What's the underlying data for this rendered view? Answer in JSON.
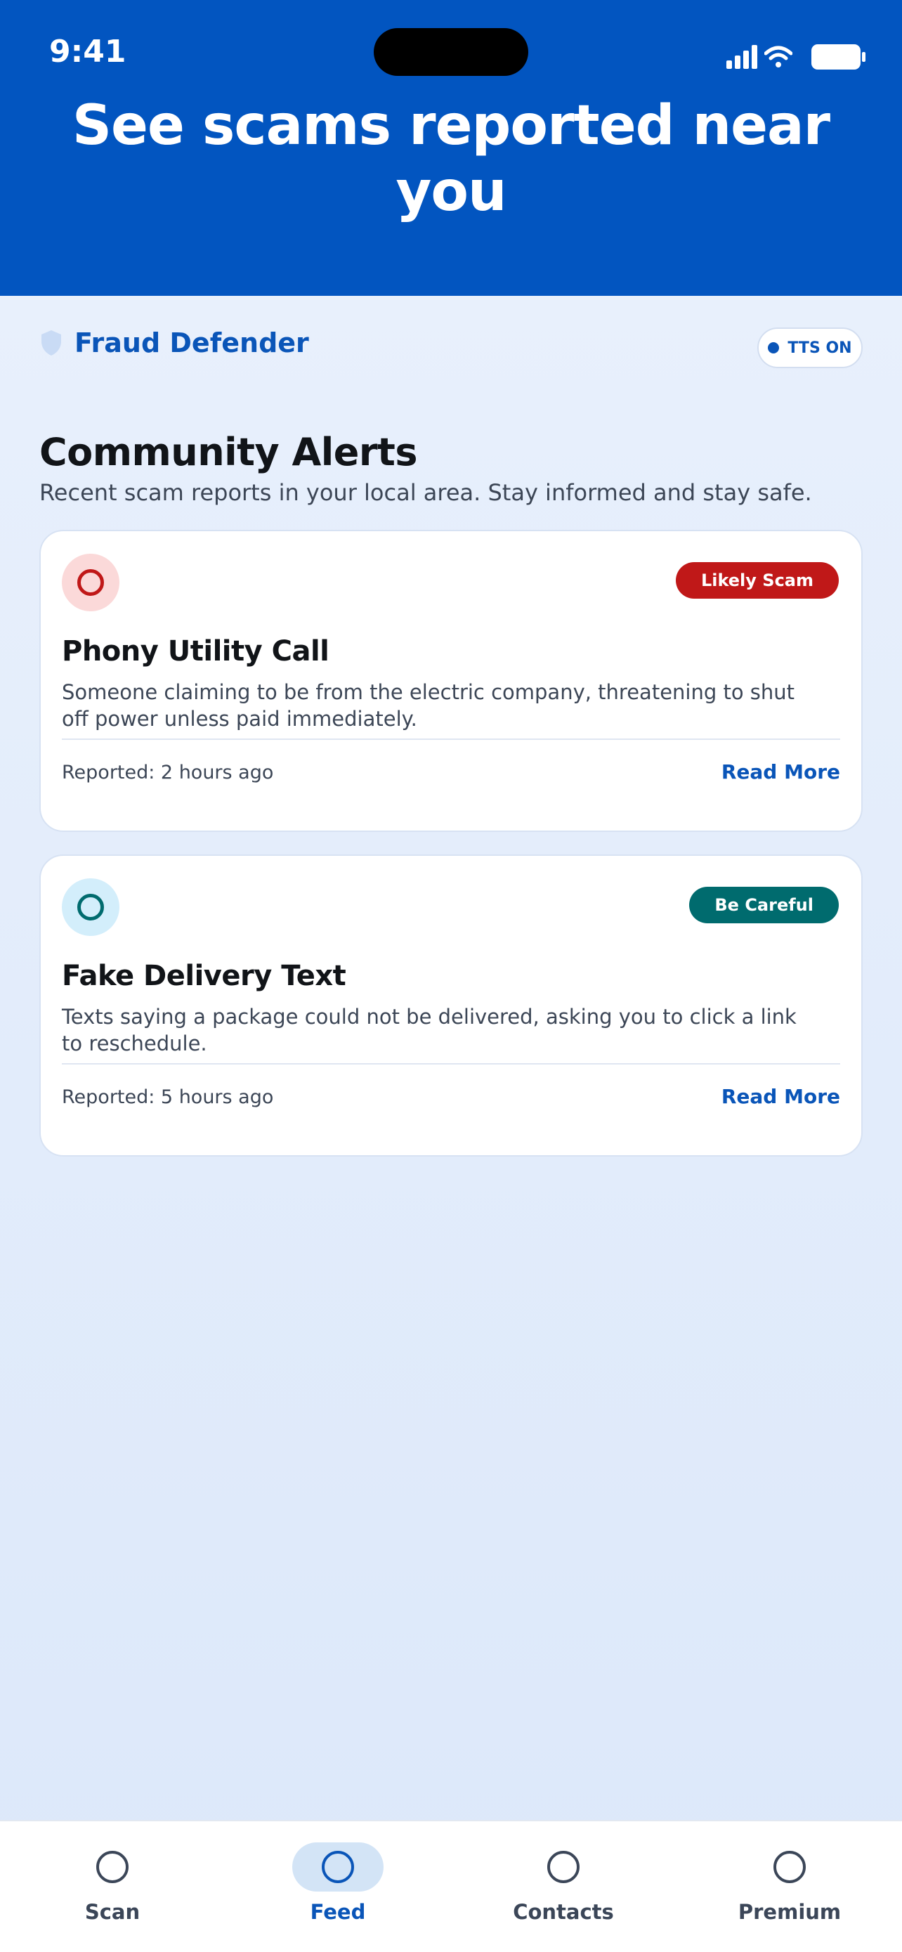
{
  "status_bar": {
    "time": "9:41"
  },
  "hero": {
    "title": "See scams reported near you"
  },
  "brand": {
    "name": "Fraud Defender"
  },
  "tts": {
    "label": "TTS ON"
  },
  "section": {
    "title": "Community Alerts",
    "subtitle": "Recent scam reports in your local area. Stay informed and stay safe."
  },
  "alerts": [
    {
      "badge": "Likely Scam",
      "title": "Phony Utility Call",
      "description": "Someone claiming to be from the electric company, threatening to shut off power unless paid immediately.",
      "reported": "Reported: 2 hours ago",
      "read_more": "Read More"
    },
    {
      "badge": "Be Careful",
      "title": "Fake Delivery Text",
      "description": "Texts saying a package could not be delivered, asking you to click a link to reschedule.",
      "reported": "Reported: 5 hours ago",
      "read_more": "Read More"
    }
  ],
  "tabs": [
    {
      "label": "Scan"
    },
    {
      "label": "Feed"
    },
    {
      "label": "Contacts"
    },
    {
      "label": "Premium"
    }
  ],
  "colors": {
    "brand_blue": "#0255c0",
    "danger": "#c01818",
    "caution": "#006b6e"
  }
}
